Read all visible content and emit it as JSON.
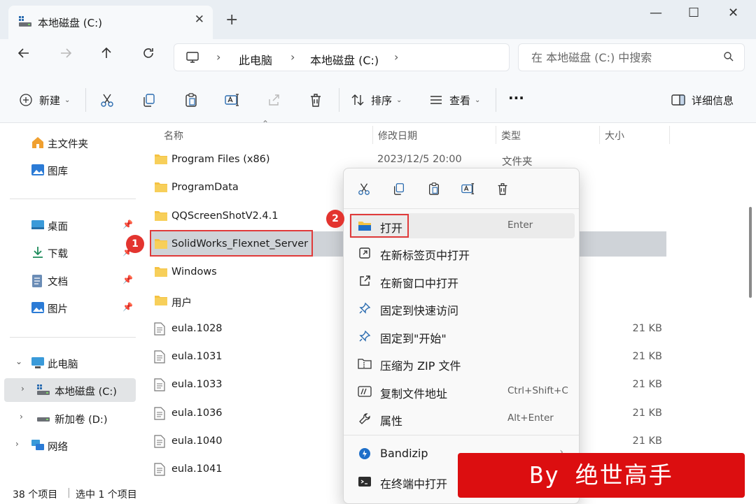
{
  "window": {
    "tab_title": "本地磁盘 (C:)",
    "tab_close": "✕",
    "new_tab": "+",
    "minimize": "—",
    "maximize": "☐",
    "close": "✕"
  },
  "address": {
    "crumbs": [
      "此电脑",
      "本地磁盘 (C:)"
    ],
    "search_placeholder": "在 本地磁盘 (C:) 中搜索"
  },
  "toolbar": {
    "new_label": "新建",
    "sort_label": "排序",
    "view_label": "查看",
    "more": "···",
    "details_label": "详细信息"
  },
  "sidebar": {
    "items": [
      {
        "label": "主文件夹",
        "icon": "home-icon"
      },
      {
        "label": "图库",
        "icon": "gallery-icon"
      },
      {
        "label": "桌面",
        "icon": "desktop-icon"
      },
      {
        "label": "下载",
        "icon": "download-icon"
      },
      {
        "label": "文档",
        "icon": "document-icon"
      },
      {
        "label": "图片",
        "icon": "pictures-icon"
      },
      {
        "label": "此电脑",
        "icon": "computer-icon"
      },
      {
        "label": "本地磁盘 (C:)",
        "icon": "drive-icon"
      },
      {
        "label": "新加卷 (D:)",
        "icon": "drive-icon"
      },
      {
        "label": "网络",
        "icon": "network-icon"
      }
    ]
  },
  "filelist": {
    "columns": {
      "name": "名称",
      "date": "修改日期",
      "type": "类型",
      "size": "大小"
    },
    "rows": [
      {
        "name": "Program Files (x86)",
        "date": "2023/12/5 20:00",
        "type": "文件夹",
        "size": "",
        "kind": "folder"
      },
      {
        "name": "ProgramData",
        "date": "",
        "type": "",
        "size": "",
        "kind": "folder"
      },
      {
        "name": "QQScreenShotV2.4.1",
        "date": "",
        "type": "",
        "size": "",
        "kind": "folder"
      },
      {
        "name": "SolidWorks_Flexnet_Server",
        "date": "",
        "type": "",
        "size": "",
        "kind": "folder"
      },
      {
        "name": "Windows",
        "date": "",
        "type": "",
        "size": "",
        "kind": "folder"
      },
      {
        "name": "用户",
        "date": "",
        "type": "",
        "size": "",
        "kind": "folder"
      },
      {
        "name": "eula.1028",
        "date": "",
        "type": "",
        "size": "21 KB",
        "kind": "file"
      },
      {
        "name": "eula.1031",
        "date": "",
        "type": "",
        "size": "21 KB",
        "kind": "file"
      },
      {
        "name": "eula.1033",
        "date": "",
        "type": "",
        "size": "21 KB",
        "kind": "file"
      },
      {
        "name": "eula.1036",
        "date": "",
        "type": "",
        "size": "21 KB",
        "kind": "file"
      },
      {
        "name": "eula.1040",
        "date": "",
        "type": "",
        "size": "21 KB",
        "kind": "file"
      },
      {
        "name": "eula.1041",
        "date": "",
        "type": "",
        "size": "",
        "kind": "file"
      }
    ]
  },
  "status": {
    "count": "38 个项目",
    "selected": "选中 1 个项目"
  },
  "context_menu": {
    "items": [
      {
        "label": "打开",
        "shortcut": "Enter",
        "icon": "folder-open-icon"
      },
      {
        "label": "在新标签页中打开",
        "shortcut": "",
        "icon": "new-tab-icon"
      },
      {
        "label": "在新窗口中打开",
        "shortcut": "",
        "icon": "new-window-icon"
      },
      {
        "label": "固定到快速访问",
        "shortcut": "",
        "icon": "pin-icon"
      },
      {
        "label": "固定到\"开始\"",
        "shortcut": "",
        "icon": "pin-start-icon"
      },
      {
        "label": "压缩为 ZIP 文件",
        "shortcut": "",
        "icon": "zip-icon"
      },
      {
        "label": "复制文件地址",
        "shortcut": "Ctrl+Shift+C",
        "icon": "copy-path-icon"
      },
      {
        "label": "属性",
        "shortcut": "Alt+Enter",
        "icon": "wrench-icon"
      },
      {
        "label": "Bandizip",
        "shortcut": "",
        "icon": "bandizip-icon"
      },
      {
        "label": "在终端中打开",
        "shortcut": "",
        "icon": "terminal-icon"
      }
    ]
  },
  "annotations": {
    "badge1": "1",
    "badge2": "2"
  },
  "watermark": "By 绝世高手",
  "colors": {
    "highlight": "#e03a3a",
    "watermark_bg": "#dc0e10",
    "folder": "#f5c242",
    "accent": "#0067c0"
  }
}
